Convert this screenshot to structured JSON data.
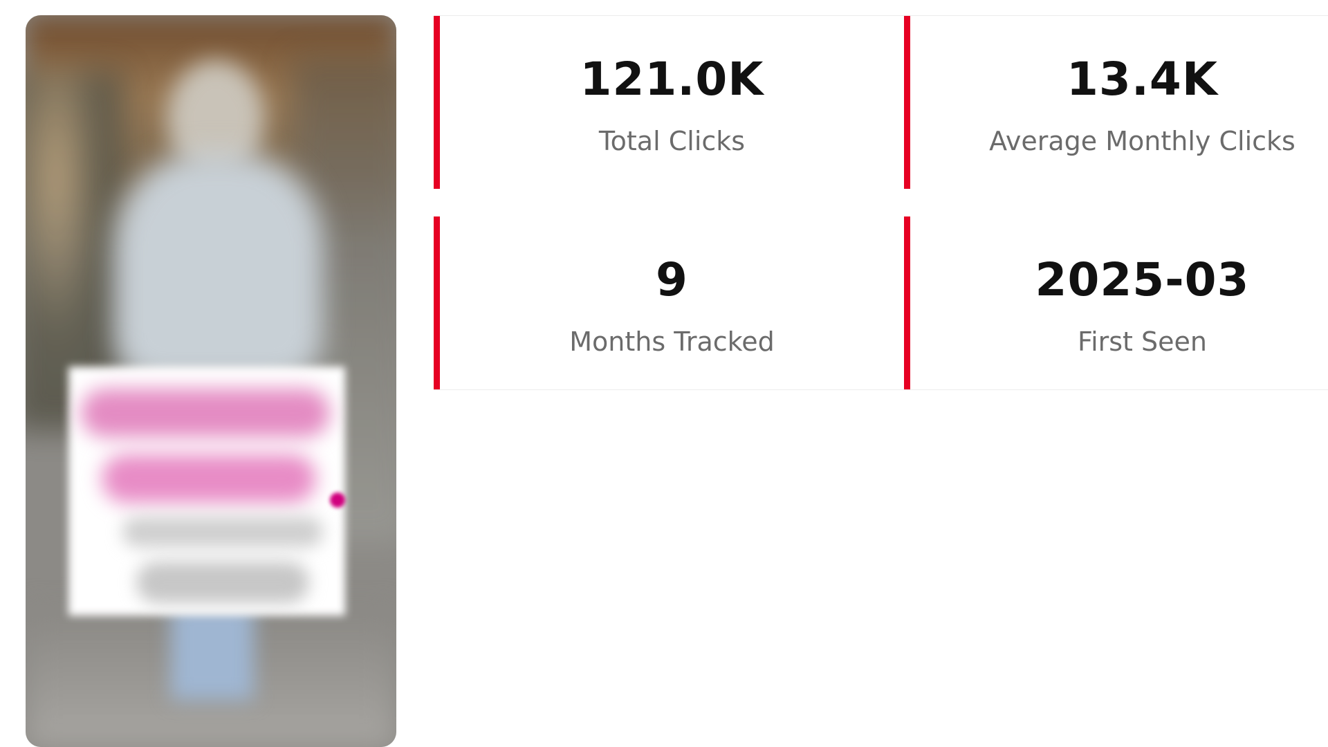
{
  "thumbnail": {
    "alt": ""
  },
  "stats": {
    "total_clicks": {
      "value": "121.0K",
      "label": "Total Clicks"
    },
    "average_monthly_clicks": {
      "value": "13.4K",
      "label": "Average Monthly Clicks"
    },
    "months_tracked": {
      "value": "9",
      "label": "Months Tracked"
    },
    "first_seen": {
      "value": "2025-03",
      "label": "First Seen"
    }
  },
  "colors": {
    "accent": "#e60023",
    "value_text": "#111111",
    "label_text": "#6b6b6b",
    "divider": "#ececec"
  }
}
